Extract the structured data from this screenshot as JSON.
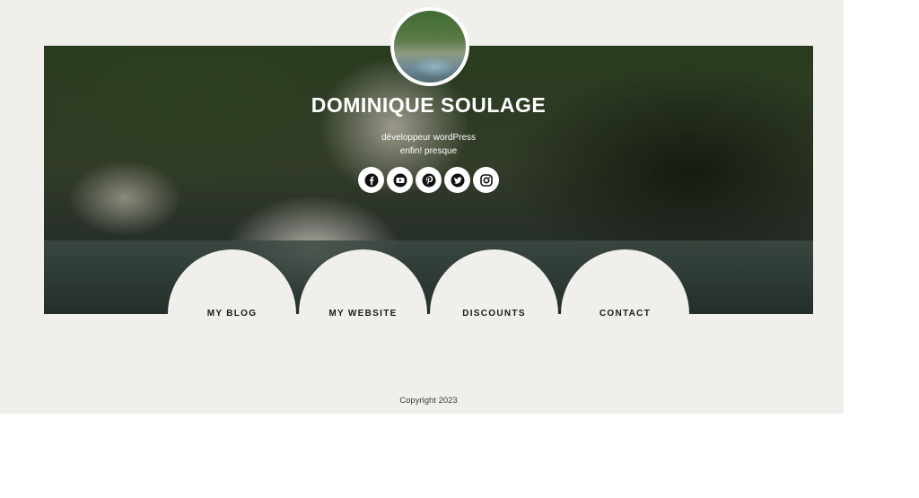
{
  "profile": {
    "name": "DOMINIQUE SOULAGE",
    "tagline_line1": "développeur wordPress",
    "tagline_line2": "enfin! presque"
  },
  "social_links": [
    {
      "icon": "facebook-icon"
    },
    {
      "icon": "youtube-icon"
    },
    {
      "icon": "pinterest-icon"
    },
    {
      "icon": "twitter-icon"
    },
    {
      "icon": "instagram-icon"
    }
  ],
  "nav": {
    "items": [
      {
        "label": "MY BLOG"
      },
      {
        "label": "MY WEBSITE"
      },
      {
        "label": "DISCOUNTS"
      },
      {
        "label": "CONTACT"
      }
    ]
  },
  "footer": {
    "copyright": "Copyright 2023"
  },
  "colors": {
    "page_background": "#f0efeb",
    "text_dark": "#1a1a1a",
    "hero_text": "#ffffff"
  }
}
